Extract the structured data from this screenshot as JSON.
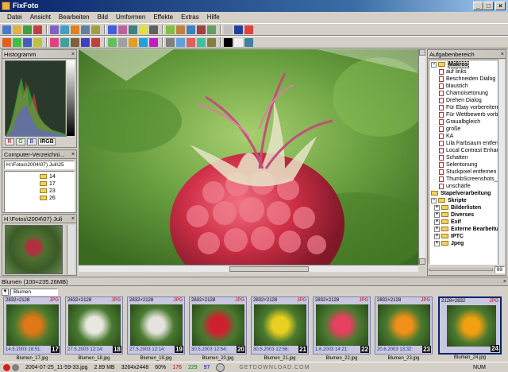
{
  "window": {
    "title": "FixFoto"
  },
  "menu": [
    "Datei",
    "Ansicht",
    "Bearbeiten",
    "Bild",
    "Umformen",
    "Effekte",
    "Extras",
    "Hilfe"
  ],
  "histogram": {
    "title": "Histogramm",
    "channels": [
      "R",
      "G",
      "B",
      "IRGB"
    ]
  },
  "folder_panel": {
    "title": "Computer-Verzeichni...",
    "path": "H:\\Fotos\\2004\\07) Juli\\25",
    "folders": [
      "14",
      "17",
      "23",
      "26"
    ]
  },
  "preview_panel": {
    "title": "H:\\Fotos\\2004\\07) Juli"
  },
  "tasks_panel": {
    "title": "Aufgabenbereich",
    "root": "Makros",
    "macros": [
      "auf links",
      "Beschneiden Dialog",
      "blaustich",
      "Chamoisetonung",
      "Drehen Dialog",
      "Für Ebay vorbereiten",
      "Für Wettbewerb vorb",
      "Graualbgleich",
      "große",
      "KA",
      "Lila Farbsaum entferr",
      "Local Contrast Enhan",
      "Schatten",
      "Selentonung",
      "Stuckpixel entfernen",
      "ThumbScreenshots_F",
      "unschärfe"
    ],
    "groups": [
      "Stapelverarbeitung",
      "Skripte"
    ],
    "scripts": [
      "Bilderlisten",
      "Diverses",
      "Exif",
      "Externe Bearbeitu",
      "IPTC",
      "Jpeg"
    ],
    "zoom_value": "99"
  },
  "strip": {
    "title": "Blumen (100=235.26MB)",
    "folder_select": "Blumen",
    "thumbs": [
      {
        "res": "2832×2128",
        "fmt": "JPG",
        "date": "14.5.2003 18:51:",
        "num": "17",
        "cap": "Blumen_17.jpg",
        "color": "#e07818"
      },
      {
        "res": "2832×2128",
        "fmt": "JPG",
        "date": "27.5.2003 12:14:",
        "num": "18",
        "cap": "Blumen_18.jpg",
        "color": "#e8e8e0"
      },
      {
        "res": "2832×2128",
        "fmt": "JPG",
        "date": "27.5.2003 12:14:",
        "num": "19",
        "cap": "Blumen_19.jpg",
        "color": "#e4e4dc"
      },
      {
        "res": "2832×2128",
        "fmt": "JPG",
        "date": "30.5.2003 12:54:",
        "num": "20",
        "cap": "Blumen_20.jpg",
        "color": "#d02030"
      },
      {
        "res": "2832×2128",
        "fmt": "JPG",
        "date": "30.5.2003 12:56:",
        "num": "21",
        "cap": "Blumen_21.jpg",
        "color": "#e8d020"
      },
      {
        "res": "2832×2128",
        "fmt": "JPG",
        "date": "1.6.2003 14:21:",
        "num": "22",
        "cap": "Blumen_22.jpg",
        "color": "#e84060"
      },
      {
        "res": "2832×2128",
        "fmt": "JPG",
        "date": "20.6.2003 13:32:",
        "num": "23",
        "cap": "Blumen_23.jpg",
        "color": "#f09018"
      },
      {
        "res": "2128×2832",
        "fmt": "JPG",
        "date": "",
        "num": "24",
        "cap": "Blumen_24.jpg",
        "color": "#f0a010"
      }
    ]
  },
  "status": {
    "file": "2004-07-25_11-59-33.jpg",
    "size": "2.89 MB",
    "dims": "3264x2448",
    "zoom": "60%",
    "v1": "176",
    "v2": "229",
    "v3": "97",
    "watermark": "GETDOWNLOAD.COM",
    "num": "NUM"
  },
  "colors": {
    "title_bar": "#0a246a",
    "accent": "#3a6ea5",
    "thumb_bg": "#c8c8e0"
  }
}
